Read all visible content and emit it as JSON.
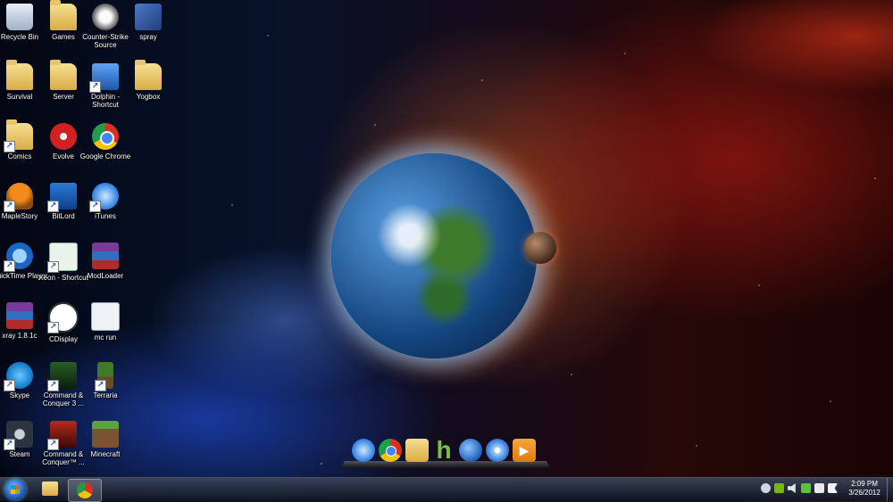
{
  "desktop": {
    "icons": [
      {
        "label": "Recycle Bin",
        "icon": "recycle-bin-icon"
      },
      {
        "label": "Games",
        "icon": "folder-icon"
      },
      {
        "label": "Counter-Strike Source",
        "icon": "counter-strike-icon"
      },
      {
        "label": "spray",
        "icon": "image-file-icon"
      },
      {
        "label": "Survival",
        "icon": "folder-icon"
      },
      {
        "label": "Server",
        "icon": "folder-icon"
      },
      {
        "label": "Dolphin - Shortcut",
        "icon": "dolphin-icon"
      },
      {
        "label": "Yogbox",
        "icon": "folder-icon"
      },
      {
        "label": "Comics",
        "icon": "folder-icon"
      },
      {
        "label": "Evolve",
        "icon": "evolve-icon"
      },
      {
        "label": "Google Chrome",
        "icon": "chrome-icon"
      },
      {
        "label": "MapleStory",
        "icon": "maplestory-icon"
      },
      {
        "label": "BitLord",
        "icon": "bitlord-icon"
      },
      {
        "label": "iTunes",
        "icon": "itunes-icon"
      },
      {
        "label": "QuickTime Player",
        "icon": "quicktime-icon"
      },
      {
        "label": "Xeon - Shortcut",
        "icon": "xeon-icon"
      },
      {
        "label": "ModLoader",
        "icon": "winrar-archive-icon"
      },
      {
        "label": "xray 1.8.1c",
        "icon": "winrar-archive-icon"
      },
      {
        "label": "CDisplay",
        "icon": "cdisplay-icon"
      },
      {
        "label": "mc run",
        "icon": "text-file-icon"
      },
      {
        "label": "Skype",
        "icon": "skype-icon"
      },
      {
        "label": "Command & Conquer 3 ...",
        "icon": "command-conquer-icon"
      },
      {
        "label": "Terraria",
        "icon": "terraria-icon"
      },
      {
        "label": "Steam",
        "icon": "steam-icon"
      },
      {
        "label": "Command & Conquer™ ...",
        "icon": "command-conquer-icon"
      },
      {
        "label": "Minecraft",
        "icon": "minecraft-icon"
      }
    ]
  },
  "dock": {
    "items": [
      "itunes-icon",
      "chrome-icon",
      "folder-icon",
      "h-app-icon",
      "earth-icon",
      "disc-burner-icon",
      "media-player-icon"
    ]
  },
  "taskbar": {
    "start": "windows-start-icon",
    "pinned": [
      "windows-explorer-icon",
      "chrome-icon"
    ],
    "tray": [
      "steam-tray-icon",
      "nvidia-icon",
      "volume-icon",
      "network-icon",
      "power-icon",
      "action-center-flag-icon"
    ],
    "clock": {
      "time": "2:09 PM",
      "date": "3/26/2012"
    }
  }
}
